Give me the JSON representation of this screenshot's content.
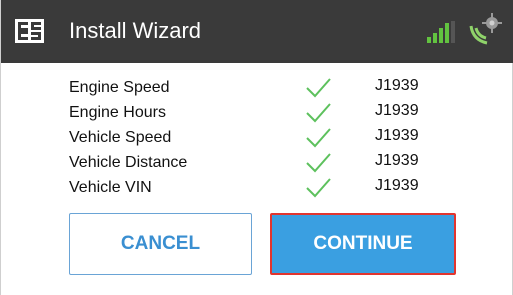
{
  "header": {
    "title": "Install Wizard",
    "logo_icon": "e-logo-icon",
    "signal_icon": "signal-strength-icon",
    "gps_icon": "gps-satellite-icon",
    "colors": {
      "bar": "#3a3a3a",
      "signal": "#62c340",
      "gps": "#8fd36a"
    }
  },
  "parameters": [
    {
      "label": "Engine Speed",
      "status": "check-icon",
      "protocol": "J1939"
    },
    {
      "label": "Engine Hours",
      "status": "check-icon",
      "protocol": "J1939"
    },
    {
      "label": "Vehicle Speed",
      "status": "check-icon",
      "protocol": "J1939"
    },
    {
      "label": "Vehicle Distance",
      "status": "check-icon",
      "protocol": "J1939"
    },
    {
      "label": "Vehicle VIN",
      "status": "check-icon",
      "protocol": "J1939"
    }
  ],
  "actions": {
    "cancel_label": "CANCEL",
    "continue_label": "CONTINUE"
  },
  "colors": {
    "check": "#5dc15d",
    "accent": "#3a9fe1",
    "highlight": "#e2352f"
  }
}
